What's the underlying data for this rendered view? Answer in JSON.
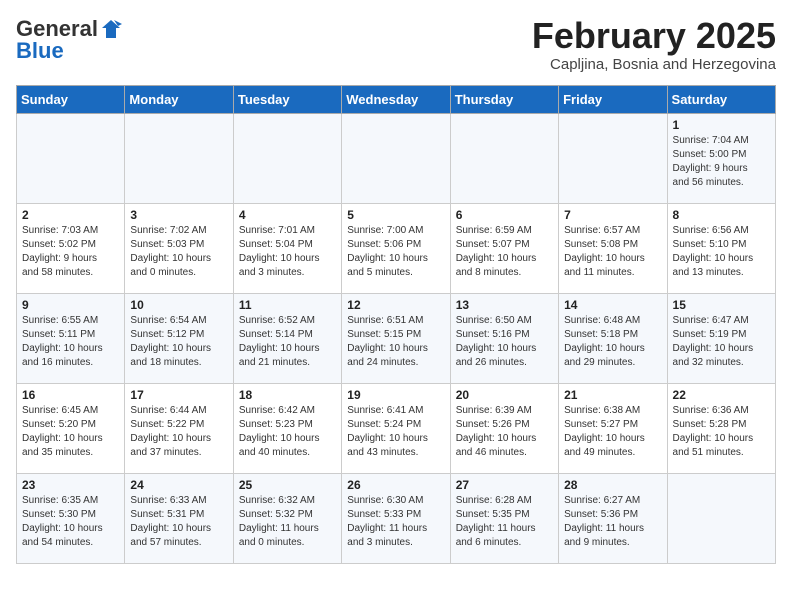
{
  "logo": {
    "general": "General",
    "blue": "Blue"
  },
  "title": {
    "month_year": "February 2025",
    "location": "Capljina, Bosnia and Herzegovina"
  },
  "weekdays": [
    "Sunday",
    "Monday",
    "Tuesday",
    "Wednesday",
    "Thursday",
    "Friday",
    "Saturday"
  ],
  "weeks": [
    [
      {
        "day": "",
        "info": ""
      },
      {
        "day": "",
        "info": ""
      },
      {
        "day": "",
        "info": ""
      },
      {
        "day": "",
        "info": ""
      },
      {
        "day": "",
        "info": ""
      },
      {
        "day": "",
        "info": ""
      },
      {
        "day": "1",
        "info": "Sunrise: 7:04 AM\nSunset: 5:00 PM\nDaylight: 9 hours\nand 56 minutes."
      }
    ],
    [
      {
        "day": "2",
        "info": "Sunrise: 7:03 AM\nSunset: 5:02 PM\nDaylight: 9 hours\nand 58 minutes."
      },
      {
        "day": "3",
        "info": "Sunrise: 7:02 AM\nSunset: 5:03 PM\nDaylight: 10 hours\nand 0 minutes."
      },
      {
        "day": "4",
        "info": "Sunrise: 7:01 AM\nSunset: 5:04 PM\nDaylight: 10 hours\nand 3 minutes."
      },
      {
        "day": "5",
        "info": "Sunrise: 7:00 AM\nSunset: 5:06 PM\nDaylight: 10 hours\nand 5 minutes."
      },
      {
        "day": "6",
        "info": "Sunrise: 6:59 AM\nSunset: 5:07 PM\nDaylight: 10 hours\nand 8 minutes."
      },
      {
        "day": "7",
        "info": "Sunrise: 6:57 AM\nSunset: 5:08 PM\nDaylight: 10 hours\nand 11 minutes."
      },
      {
        "day": "8",
        "info": "Sunrise: 6:56 AM\nSunset: 5:10 PM\nDaylight: 10 hours\nand 13 minutes."
      }
    ],
    [
      {
        "day": "9",
        "info": "Sunrise: 6:55 AM\nSunset: 5:11 PM\nDaylight: 10 hours\nand 16 minutes."
      },
      {
        "day": "10",
        "info": "Sunrise: 6:54 AM\nSunset: 5:12 PM\nDaylight: 10 hours\nand 18 minutes."
      },
      {
        "day": "11",
        "info": "Sunrise: 6:52 AM\nSunset: 5:14 PM\nDaylight: 10 hours\nand 21 minutes."
      },
      {
        "day": "12",
        "info": "Sunrise: 6:51 AM\nSunset: 5:15 PM\nDaylight: 10 hours\nand 24 minutes."
      },
      {
        "day": "13",
        "info": "Sunrise: 6:50 AM\nSunset: 5:16 PM\nDaylight: 10 hours\nand 26 minutes."
      },
      {
        "day": "14",
        "info": "Sunrise: 6:48 AM\nSunset: 5:18 PM\nDaylight: 10 hours\nand 29 minutes."
      },
      {
        "day": "15",
        "info": "Sunrise: 6:47 AM\nSunset: 5:19 PM\nDaylight: 10 hours\nand 32 minutes."
      }
    ],
    [
      {
        "day": "16",
        "info": "Sunrise: 6:45 AM\nSunset: 5:20 PM\nDaylight: 10 hours\nand 35 minutes."
      },
      {
        "day": "17",
        "info": "Sunrise: 6:44 AM\nSunset: 5:22 PM\nDaylight: 10 hours\nand 37 minutes."
      },
      {
        "day": "18",
        "info": "Sunrise: 6:42 AM\nSunset: 5:23 PM\nDaylight: 10 hours\nand 40 minutes."
      },
      {
        "day": "19",
        "info": "Sunrise: 6:41 AM\nSunset: 5:24 PM\nDaylight: 10 hours\nand 43 minutes."
      },
      {
        "day": "20",
        "info": "Sunrise: 6:39 AM\nSunset: 5:26 PM\nDaylight: 10 hours\nand 46 minutes."
      },
      {
        "day": "21",
        "info": "Sunrise: 6:38 AM\nSunset: 5:27 PM\nDaylight: 10 hours\nand 49 minutes."
      },
      {
        "day": "22",
        "info": "Sunrise: 6:36 AM\nSunset: 5:28 PM\nDaylight: 10 hours\nand 51 minutes."
      }
    ],
    [
      {
        "day": "23",
        "info": "Sunrise: 6:35 AM\nSunset: 5:30 PM\nDaylight: 10 hours\nand 54 minutes."
      },
      {
        "day": "24",
        "info": "Sunrise: 6:33 AM\nSunset: 5:31 PM\nDaylight: 10 hours\nand 57 minutes."
      },
      {
        "day": "25",
        "info": "Sunrise: 6:32 AM\nSunset: 5:32 PM\nDaylight: 11 hours\nand 0 minutes."
      },
      {
        "day": "26",
        "info": "Sunrise: 6:30 AM\nSunset: 5:33 PM\nDaylight: 11 hours\nand 3 minutes."
      },
      {
        "day": "27",
        "info": "Sunrise: 6:28 AM\nSunset: 5:35 PM\nDaylight: 11 hours\nand 6 minutes."
      },
      {
        "day": "28",
        "info": "Sunrise: 6:27 AM\nSunset: 5:36 PM\nDaylight: 11 hours\nand 9 minutes."
      },
      {
        "day": "",
        "info": ""
      }
    ]
  ]
}
